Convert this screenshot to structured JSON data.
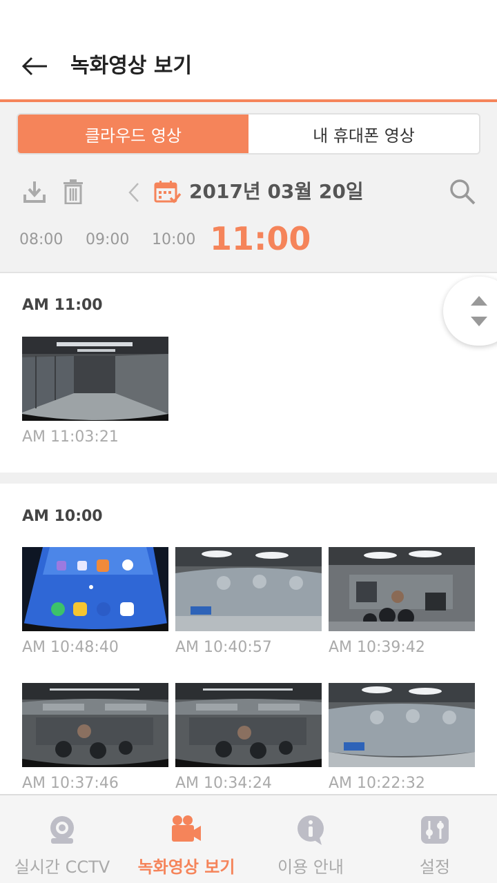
{
  "header": {
    "title": "녹화영상 보기"
  },
  "tabs": [
    {
      "label": "클라우드 영상",
      "active": true
    },
    {
      "label": "내 휴대폰 영상",
      "active": false
    }
  ],
  "date": {
    "label": "2017년 03월 20일"
  },
  "hours": [
    {
      "label": "08:00",
      "active": false
    },
    {
      "label": "09:00",
      "active": false
    },
    {
      "label": "10:00",
      "active": false
    },
    {
      "label": "11:00",
      "active": true
    }
  ],
  "sections": [
    {
      "title": "AM 11:00",
      "clips": [
        {
          "time": "AM 11:03:21",
          "scene": "hallway"
        }
      ]
    },
    {
      "title": "AM 10:00",
      "clips": [
        {
          "time": "AM 10:48:40",
          "scene": "phone-home"
        },
        {
          "time": "AM 10:40:57",
          "scene": "tv-menu"
        },
        {
          "time": "AM 10:39:42",
          "scene": "office"
        },
        {
          "time": "AM 10:37:46",
          "scene": "tv-overlay"
        },
        {
          "time": "AM 10:34:24",
          "scene": "tv-overlay"
        },
        {
          "time": "AM 10:22:32",
          "scene": "tv-menu"
        }
      ]
    }
  ],
  "bottom_nav": [
    {
      "label": "실시간 CCTV",
      "icon": "camera-icon",
      "active": false
    },
    {
      "label": "녹화영상 보기",
      "icon": "video-camera-icon",
      "active": true
    },
    {
      "label": "이용 안내",
      "icon": "info-chat-icon",
      "active": false
    },
    {
      "label": "설정",
      "icon": "settings-icon",
      "active": false
    }
  ],
  "colors": {
    "accent": "#f5845a",
    "inactive_icon": "#bdbdc6",
    "muted_text": "#aaaaaa"
  }
}
